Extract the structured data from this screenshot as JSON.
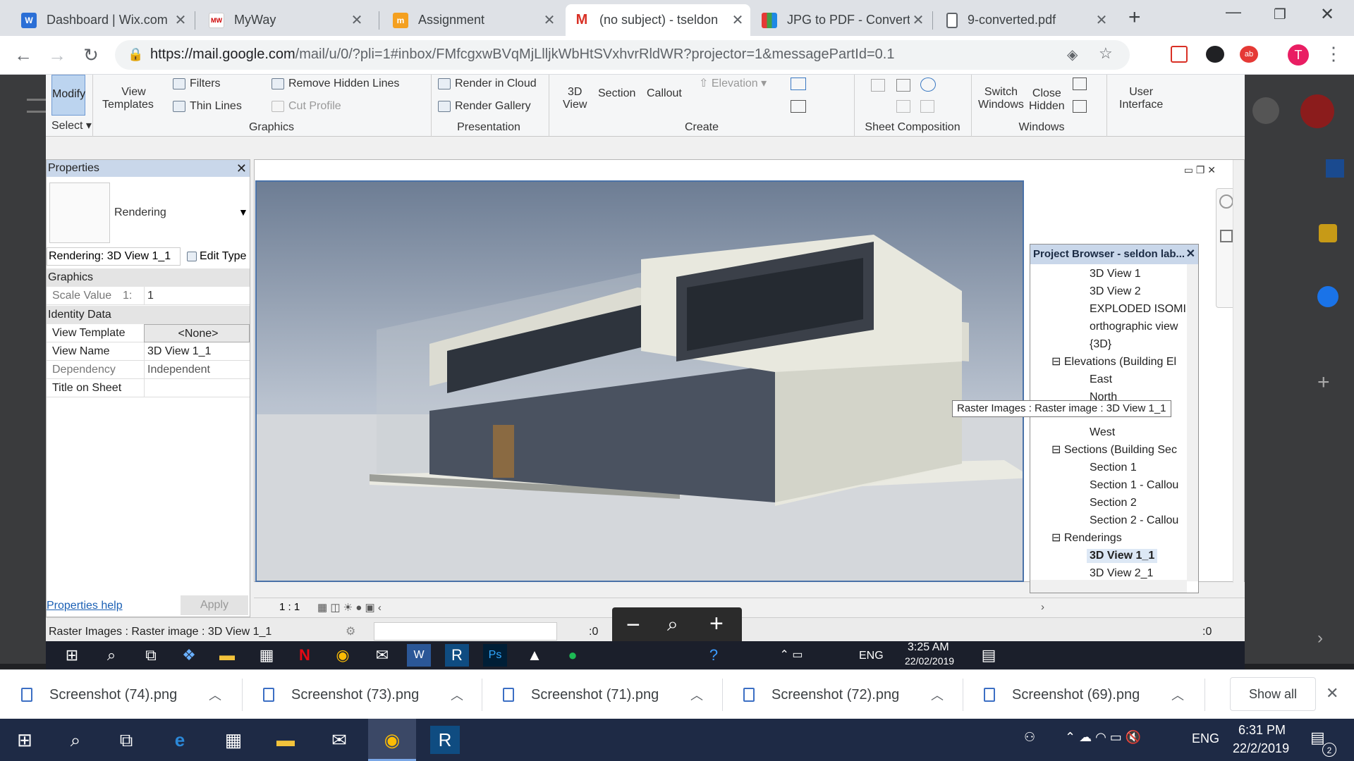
{
  "browser": {
    "tabs": [
      {
        "title": "Dashboard | Wix.com",
        "fav_color": "#2b6fd6",
        "fav_glyph": "W"
      },
      {
        "title": "MyWay",
        "fav_color": "#ffffff",
        "fav_glyph": "MW"
      },
      {
        "title": "Assignment",
        "fav_color": "#f4a020",
        "fav_glyph": "m"
      },
      {
        "title": "(no subject) - tseldon",
        "fav_color": "#d93025",
        "fav_glyph": "M",
        "active": true
      },
      {
        "title": "JPG to PDF - Convert",
        "fav_color": "#8e44ad",
        "fav_glyph": "▦"
      },
      {
        "title": "9-converted.pdf",
        "fav_color": "#ffffff",
        "fav_glyph": "▯"
      }
    ],
    "url_host": "https://mail.google.com",
    "url_path": "/mail/u/0/?pli=1#inbox/FMfcgxwBVqMjLlljkWbHtSVxhvrRldWR?projector=1&messagePartId=0.1",
    "profile_initial": "T"
  },
  "revit": {
    "ribbon": {
      "modify": "Modify",
      "select": "Select",
      "view_templates_1": "View",
      "view_templates_2": "Templates",
      "filters": "Filters",
      "thin_lines": "Thin  Lines",
      "remove_hidden": "Remove  Hidden Lines",
      "cut_profile": "Cut  Profile",
      "render_cloud": "Render  in Cloud",
      "render_gallery": "Render  Gallery",
      "view3d_1": "3D",
      "view3d_2": "View",
      "section": "Section",
      "callout": "Callout",
      "elevation": "Elevation",
      "switch_windows_1": "Switch",
      "switch_windows_2": "Windows",
      "close_hidden_1": "Close",
      "close_hidden_2": "Hidden",
      "user_interface_1": "User",
      "user_interface_2": "Interface",
      "groups": {
        "graphics": "Graphics",
        "presentation": "Presentation",
        "create": "Create",
        "sheet_composition": "Sheet Composition",
        "windows": "Windows"
      }
    },
    "properties": {
      "title": "Properties",
      "type_name": "Rendering",
      "instance_selector": "Rendering: 3D View 1_1",
      "edit_type": "Edit Type",
      "section_graphics": "Graphics",
      "scale_label": "Scale Value",
      "scale_prefix": "1:",
      "scale_value": "1",
      "section_identity": "Identity Data",
      "view_template_label": "View Template",
      "view_template_value": "<None>",
      "view_name_label": "View Name",
      "view_name_value": "3D View 1_1",
      "dependency_label": "Dependency",
      "dependency_value": "Independent",
      "title_on_sheet_label": "Title on Sheet",
      "title_on_sheet_value": "",
      "help_link": "Properties help",
      "apply": "Apply"
    },
    "project_browser": {
      "title": "Project Browser - seldon lab...",
      "items": [
        {
          "label": "3D View 1",
          "level": 2
        },
        {
          "label": "3D View 2",
          "level": 2
        },
        {
          "label": "EXPLODED ISOMI",
          "level": 2
        },
        {
          "label": "orthographic view",
          "level": 2
        },
        {
          "label": "{3D}",
          "level": 2
        },
        {
          "label": "Elevations (Building El",
          "level": 1
        },
        {
          "label": "East",
          "level": 2
        },
        {
          "label": "North",
          "level": 2
        },
        {
          "label": "West",
          "level": 2
        },
        {
          "label": "Sections (Building Sec",
          "level": 1
        },
        {
          "label": "Section 1",
          "level": 2
        },
        {
          "label": "Section 1 - Callou",
          "level": 2
        },
        {
          "label": "Section 2",
          "level": 2
        },
        {
          "label": "Section 2 - Callou",
          "level": 2
        },
        {
          "label": "Renderings",
          "level": 1
        },
        {
          "label": "3D View 1_1",
          "level": 2,
          "selected": true
        },
        {
          "label": "3D View 2_1",
          "level": 2
        }
      ]
    },
    "tooltip": "Raster Images : Raster image : 3D View 1_1",
    "view_scale": "1 : 1",
    "status_text": "Raster Images : Raster image : 3D View 1_1",
    "status_zero_1": ":0",
    "status_zero_2": ":0",
    "inner_clock_time": "3:25 AM",
    "inner_clock_date": "22/02/2019",
    "inner_lang": "ENG"
  },
  "downloads": {
    "items": [
      "Screenshot (74).png",
      "Screenshot (73).png",
      "Screenshot (71).png",
      "Screenshot (72).png",
      "Screenshot (69).png"
    ],
    "show_all": "Show all"
  },
  "taskbar": {
    "time": "6:31 PM",
    "date": "22/2/2019",
    "lang": "ENG",
    "notifications": "2"
  }
}
